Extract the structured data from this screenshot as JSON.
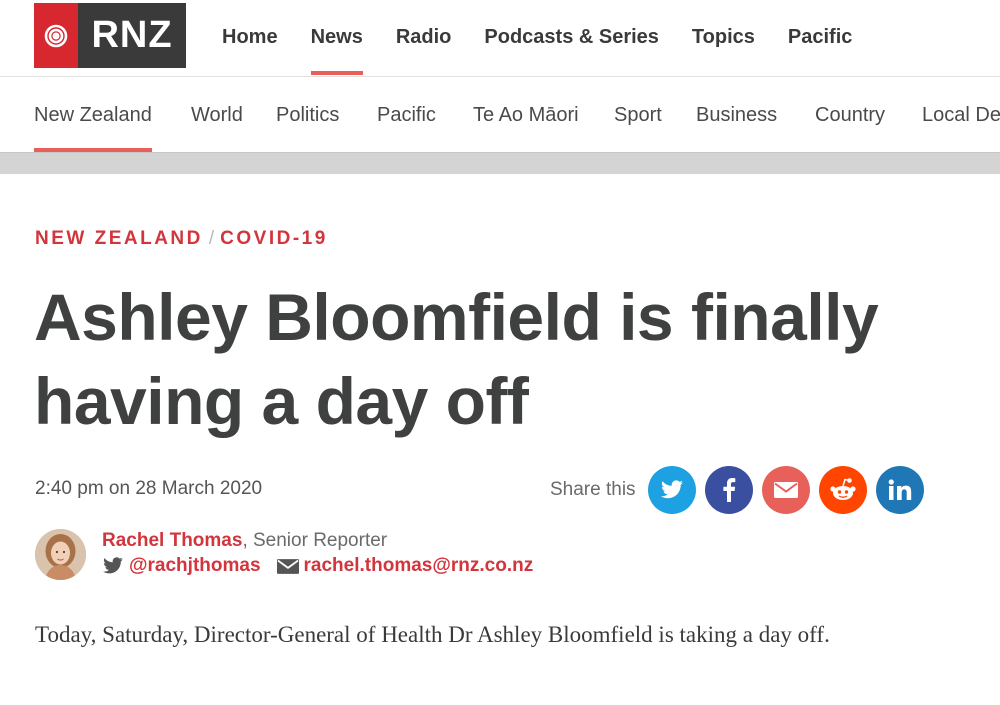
{
  "brand": {
    "logo_text": "RNZ",
    "accent": "#d8282f",
    "underline": "#e8605a"
  },
  "main_nav": [
    "Home",
    "News",
    "Radio",
    "Podcasts & Series",
    "Topics",
    "Pacific"
  ],
  "main_nav_active": "News",
  "section_nav": [
    "New Zealand",
    "World",
    "Politics",
    "Pacific",
    "Te Ao Māori",
    "Sport",
    "Business",
    "Country",
    "Local Democracy Reporting"
  ],
  "section_nav_active": "New Zealand",
  "article": {
    "breadcrumb": [
      "NEW ZEALAND",
      "COVID-19"
    ],
    "breadcrumb_sep": "/",
    "headline": "Ashley Bloomfield is finally having a day off",
    "date": "2:40 pm on 28 March 2020",
    "share_label": "Share this",
    "share_buttons": [
      {
        "name": "twitter",
        "icon": "twitter-icon",
        "color": "#1da1e2"
      },
      {
        "name": "facebook",
        "icon": "facebook-icon",
        "color": "#3b4fa0"
      },
      {
        "name": "email",
        "icon": "envelope-icon",
        "color": "#e8605a"
      },
      {
        "name": "reddit",
        "icon": "reddit-icon",
        "color": "#ff4500"
      },
      {
        "name": "linkedin",
        "icon": "linkedin-icon",
        "color": "#1f77b5"
      }
    ],
    "author": {
      "name": "Rachel Thomas",
      "role": ", Senior Reporter",
      "twitter": "@rachjthomas",
      "email": "rachel.thomas@rnz.co.nz"
    },
    "body": "Today, Saturday, Director-General of Health Dr Ashley Bloomfield is taking a day off."
  }
}
